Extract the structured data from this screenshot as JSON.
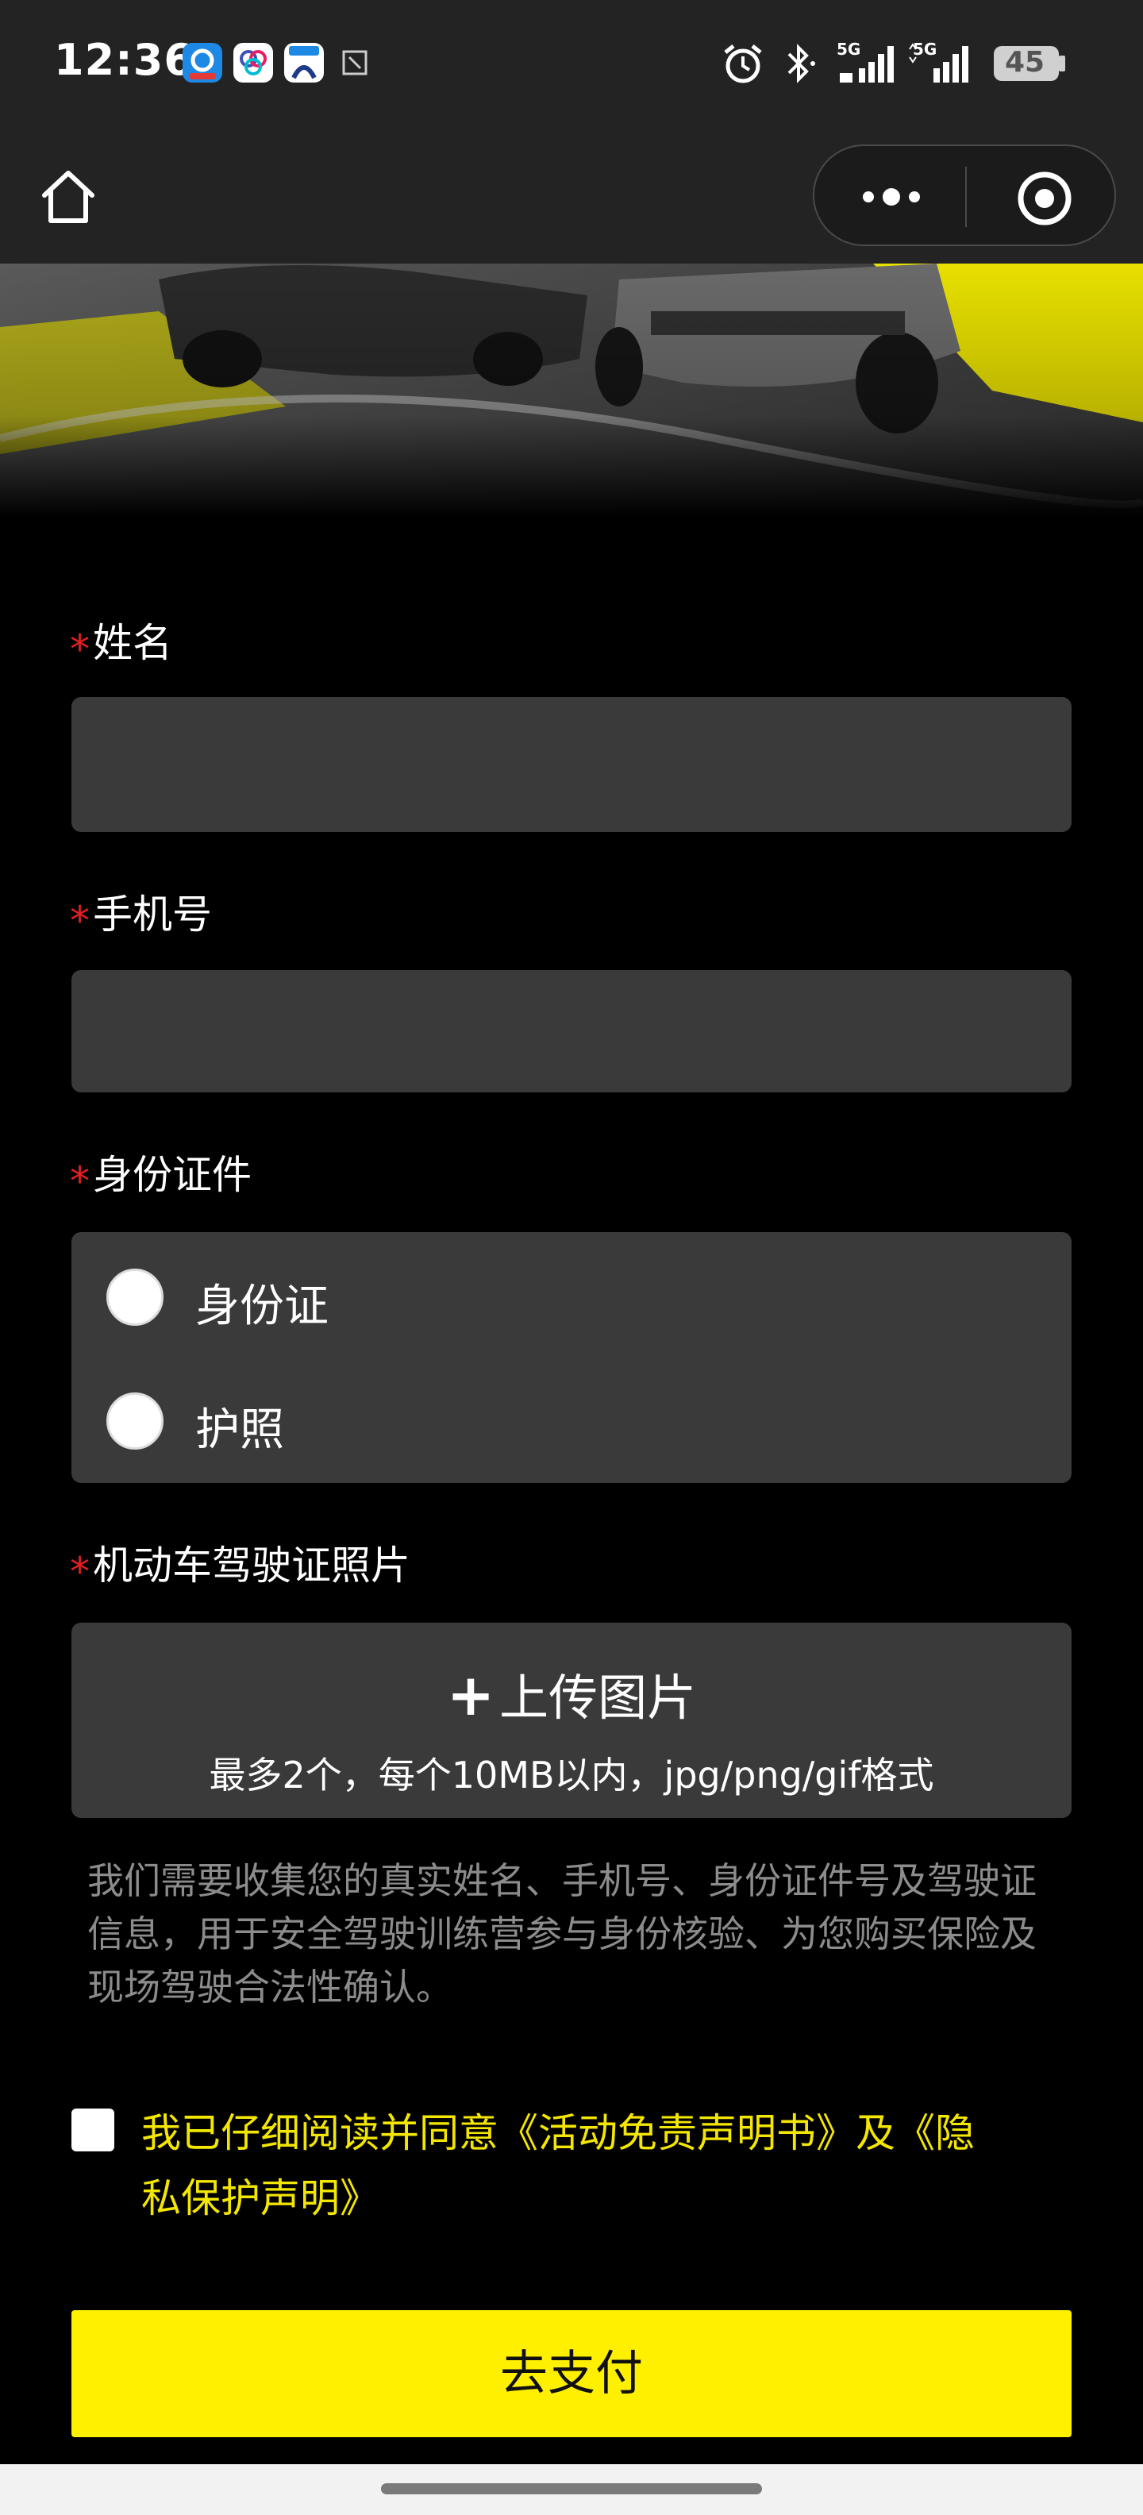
{
  "status_bar": {
    "time": "12:36",
    "battery": "45",
    "network_1": "5G",
    "network_2": "5G",
    "icons": [
      "alarm-icon",
      "bluetooth-icon",
      "signal-icon",
      "signal-icon",
      "battery-icon"
    ]
  },
  "nav": {
    "home_icon": "home-icon",
    "more_icon": "more-dots-icon",
    "close_icon": "target-circle-icon"
  },
  "form": {
    "required_mark": "*",
    "name_label": "姓名",
    "phone_label": "手机号",
    "id_label": "身份证件",
    "id_options": [
      "身份证",
      "护照"
    ],
    "license_label": "机动车驾驶证照片",
    "upload_plus": "+",
    "upload_label": "上传图片",
    "upload_hint": "最多2个，每个10MB以内，jpg/png/gif格式",
    "notice": "我们需要收集您的真实姓名、手机号、身份证件号及驾驶证信息，用于安全驾驶训练营参与身份核验、为您购买保险及现场驾驶合法性确认。",
    "agree_text": "我已仔细阅读并同意《活动免责声明书》及《隐私保护声明》",
    "pay_label": "去支付"
  },
  "colors": {
    "accent": "#fff000",
    "required": "#e02020",
    "field_bg": "#3a3a3a",
    "agree_text": "#f3e600"
  }
}
